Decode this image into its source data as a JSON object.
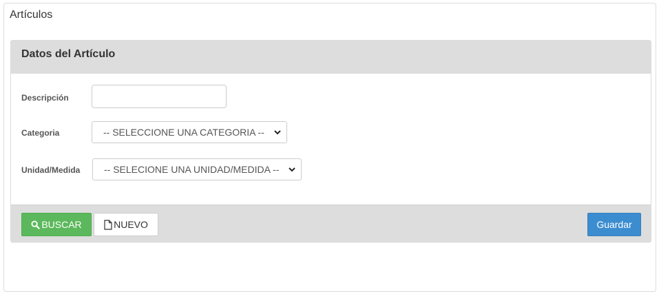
{
  "page": {
    "title": "Artículos"
  },
  "panel": {
    "title": "Datos del Artículo"
  },
  "form": {
    "descripcion": {
      "label": "Descripción",
      "value": "",
      "placeholder": ""
    },
    "categoria": {
      "label": "Categoria",
      "selected": "-- SELECCIONE UNA CATEGORIA --"
    },
    "unidad": {
      "label": "Unidad/Medida",
      "selected": "-- SELECIONE UNA UNIDAD/MEDIDA --"
    }
  },
  "footer": {
    "buscar_label": "BUSCAR",
    "nuevo_label": "NUEVO",
    "guardar_label": "Guardar"
  },
  "icons": {
    "buscar": "search-icon",
    "nuevo": "file-icon",
    "select": "chevron-down-icon"
  },
  "colors": {
    "success": "#5cb85c",
    "primary": "#3c8dd0",
    "panel_header": "#dddddd"
  }
}
